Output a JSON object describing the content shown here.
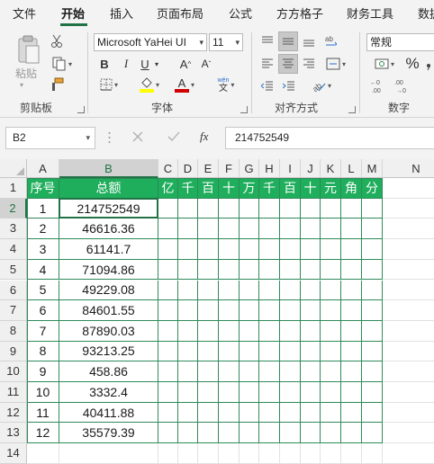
{
  "tabs": [
    "文件",
    "开始",
    "插入",
    "页面布局",
    "公式",
    "方方格子",
    "财务工具",
    "数据"
  ],
  "active_tab": "开始",
  "ribbon": {
    "clipboard": {
      "paste_label": "粘贴",
      "group_label": "剪贴板"
    },
    "font": {
      "font_name": "Microsoft YaHei UI",
      "font_size": "11",
      "bold": "B",
      "italic": "I",
      "underline": "U",
      "grow": "A",
      "shrink": "A",
      "phonetic_top": "wén",
      "phonetic_bottom": "文",
      "font_color": "A",
      "group_label": "字体"
    },
    "alignment": {
      "group_label": "对齐方式"
    },
    "number": {
      "format": "常规",
      "percent": "%",
      "group_label": "数字"
    }
  },
  "formula_bar": {
    "name_box": "B2",
    "fx": "fx",
    "value": "214752549"
  },
  "sheet": {
    "columns": [
      "A",
      "B",
      "C",
      "D",
      "E",
      "F",
      "G",
      "H",
      "I",
      "J",
      "K",
      "L",
      "M",
      "N"
    ],
    "selected_column": "B",
    "row_numbers": [
      "1",
      "2",
      "3",
      "4",
      "5",
      "6",
      "7",
      "8",
      "9",
      "10",
      "11",
      "12",
      "13",
      "14"
    ],
    "selected_row": "2",
    "header_row": [
      "序号",
      "总额",
      "亿",
      "千",
      "百",
      "十",
      "万",
      "千",
      "百",
      "十",
      "元",
      "角",
      "分"
    ],
    "rows": [
      [
        "1",
        "214752549"
      ],
      [
        "2",
        "46616.36"
      ],
      [
        "3",
        "61141.7"
      ],
      [
        "4",
        "71094.86"
      ],
      [
        "5",
        "49229.08"
      ],
      [
        "6",
        "84601.55"
      ],
      [
        "7",
        "87890.03"
      ],
      [
        "8",
        "93213.25"
      ],
      [
        "9",
        "458.86"
      ],
      [
        "10",
        "3332.4"
      ],
      [
        "11",
        "40411.88"
      ],
      [
        "12",
        "35579.39"
      ]
    ]
  },
  "colors": {
    "accent": "#217346",
    "header_fill": "#1fae5c",
    "border": "#2e8a5a",
    "font_color_bar": "#d00000",
    "fill_color_bar": "#ffff00"
  }
}
